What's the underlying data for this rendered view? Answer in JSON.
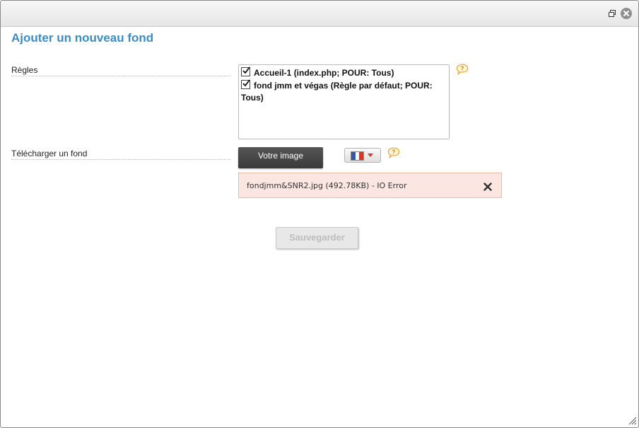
{
  "window": {
    "restore_icon": "restore-window-icon",
    "close_icon": "close-circle-icon"
  },
  "form": {
    "title": "Ajouter un nouveau fond",
    "rules_label": "Règles",
    "rules": [
      {
        "label": "Accueil-1 (index.php; POUR: Tous)",
        "checked": true
      },
      {
        "label": "fond jmm et végas (Règle par défaut; POUR: Tous)",
        "checked": true
      }
    ],
    "upload_label": "Télécharger un fond",
    "upload_button": "Votre image",
    "language": {
      "selected": "fr",
      "icon": "flag-france-icon"
    },
    "upload_error": {
      "text": "fondjmm&SNR2.jpg (492.78KB) - IO Error",
      "close_icon": "close-x-icon"
    },
    "save_button": "Sauvegarder",
    "help_icon": "help-speech-bubble-icon"
  },
  "colors": {
    "title": "#3b8dc1",
    "error_bg": "#fbe6e1",
    "error_border": "#f0b8a9",
    "help_icon": "#e8a33a",
    "upload_button_bg": "#444444"
  }
}
